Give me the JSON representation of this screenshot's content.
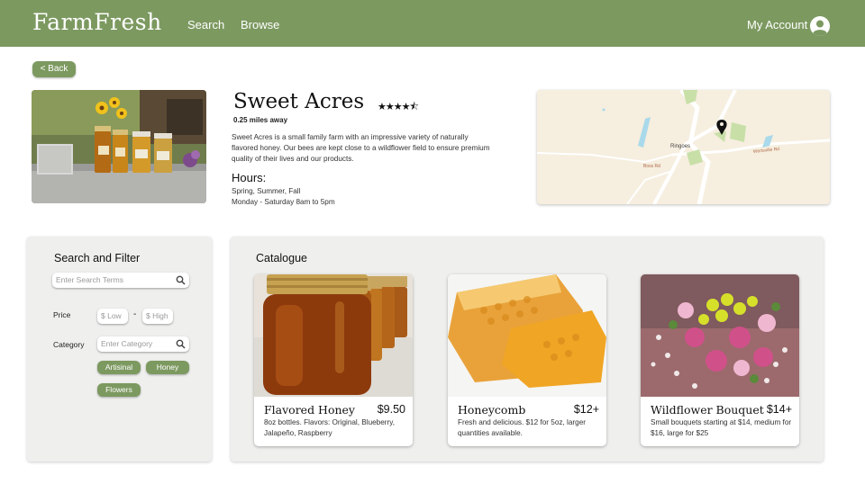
{
  "header": {
    "logo": "FarmFresh",
    "nav": [
      "Search",
      "Browse"
    ],
    "account_label": "My Account",
    "account_icon": "user-circle-icon"
  },
  "back_label": "< Back",
  "farm": {
    "name": "Sweet Acres",
    "rating": 4.5,
    "rating_max": 5,
    "stars": "★★★★⯪",
    "distance": "0.25 miles away",
    "description": "Sweet Acres is a small family farm with an impressive variety of naturally flavored honey. Our bees are kept close to a wildflower field to ensure premium quality of their lives and our products.",
    "hours_heading": "Hours:",
    "hours_days": "Spring, Summer, Fall",
    "hours_times": "Monday - Saturday 8am to 5pm"
  },
  "map": {
    "town": "Ringoes",
    "road_1": "Wertsville Rd",
    "road_2": "Boss Rd",
    "pin_icon": "map-pin-icon"
  },
  "filter": {
    "title": "Search and Filter",
    "search_placeholder": "Enter Search Terms",
    "price_label": "Price",
    "price_low_placeholder": "$ Low",
    "price_sep": "-",
    "price_high_placeholder": "$ High",
    "category_label": "Category",
    "category_placeholder": "Enter Category",
    "chips": [
      "Artisinal",
      "Honey",
      "Flowers"
    ]
  },
  "catalogue": {
    "title": "Catalogue",
    "items": [
      {
        "name": "Flavored Honey",
        "price": "$9.50",
        "description": "8oz bottles. Flavors: Original, Blueberry, Jalapeño,  Raspberry"
      },
      {
        "name": "Honeycomb",
        "price": "$12+",
        "description": "Fresh and delicious. $12 for 5oz, larger quantities available."
      },
      {
        "name": "Wildflower Bouquet",
        "price": "$14+",
        "description": "Small bouquets starting at $14, medium for $16, large for $25"
      }
    ]
  },
  "colors": {
    "brand_green": "#7c9960",
    "panel_bg": "#efefed",
    "map_bg": "#f6eedf"
  }
}
